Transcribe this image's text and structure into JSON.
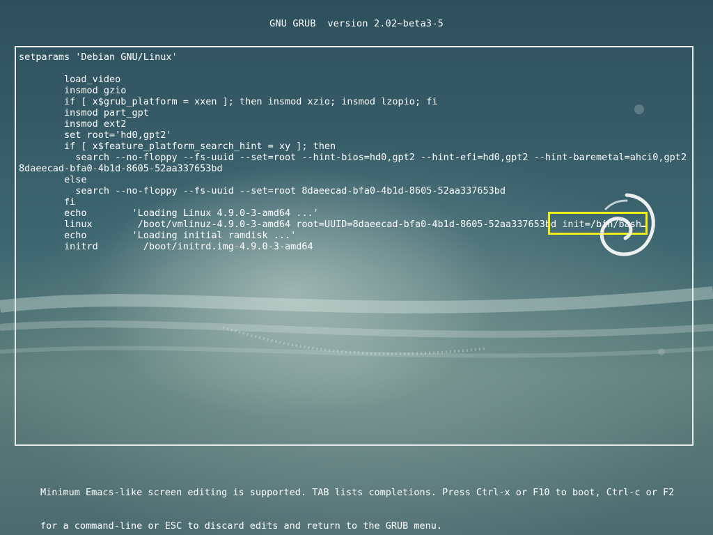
{
  "header": {
    "title": "GNU GRUB  version 2.02~beta3-5"
  },
  "editor": {
    "lines": [
      "setparams 'Debian GNU/Linux'",
      "",
      "        load_video",
      "        insmod gzio",
      "        if [ x$grub_platform = xxen ]; then insmod xzio; insmod lzopio; fi",
      "        insmod part_gpt",
      "        insmod ext2",
      "        set root='hd0,gpt2'",
      "        if [ x$feature_platform_search_hint = xy ]; then",
      "          search --no-floppy --fs-uuid --set=root --hint-bios=hd0,gpt2 --hint-efi=hd0,gpt2 --hint-baremetal=ahci0,gpt2  \\",
      "8daeecad-bfa0-4b1d-8605-52aa337653bd",
      "        else",
      "          search --no-floppy --fs-uuid --set=root 8daeecad-bfa0-4b1d-8605-52aa337653bd",
      "        fi",
      "        echo        'Loading Linux 4.9.0-3-amd64 ...'",
      "        linux        /boot/vmlinuz-4.9.0-3-amd64 root=UUID=8daeecad-bfa0-4b1d-8605-52aa337653bd init=/bin/bash",
      "        echo        'Loading initial ramdisk ...'",
      "        initrd        /boot/initrd.img-4.9.0-3-amd64"
    ],
    "highlight_color": "#f2ee1a"
  },
  "help": {
    "line1": "Minimum Emacs-like screen editing is supported. TAB lists completions. Press Ctrl-x or F10 to boot, Ctrl-c or F2",
    "line2": "for a command-line or ESC to discard edits and return to the GRUB menu."
  },
  "icons": {
    "logo": "debian-swirl-icon"
  }
}
